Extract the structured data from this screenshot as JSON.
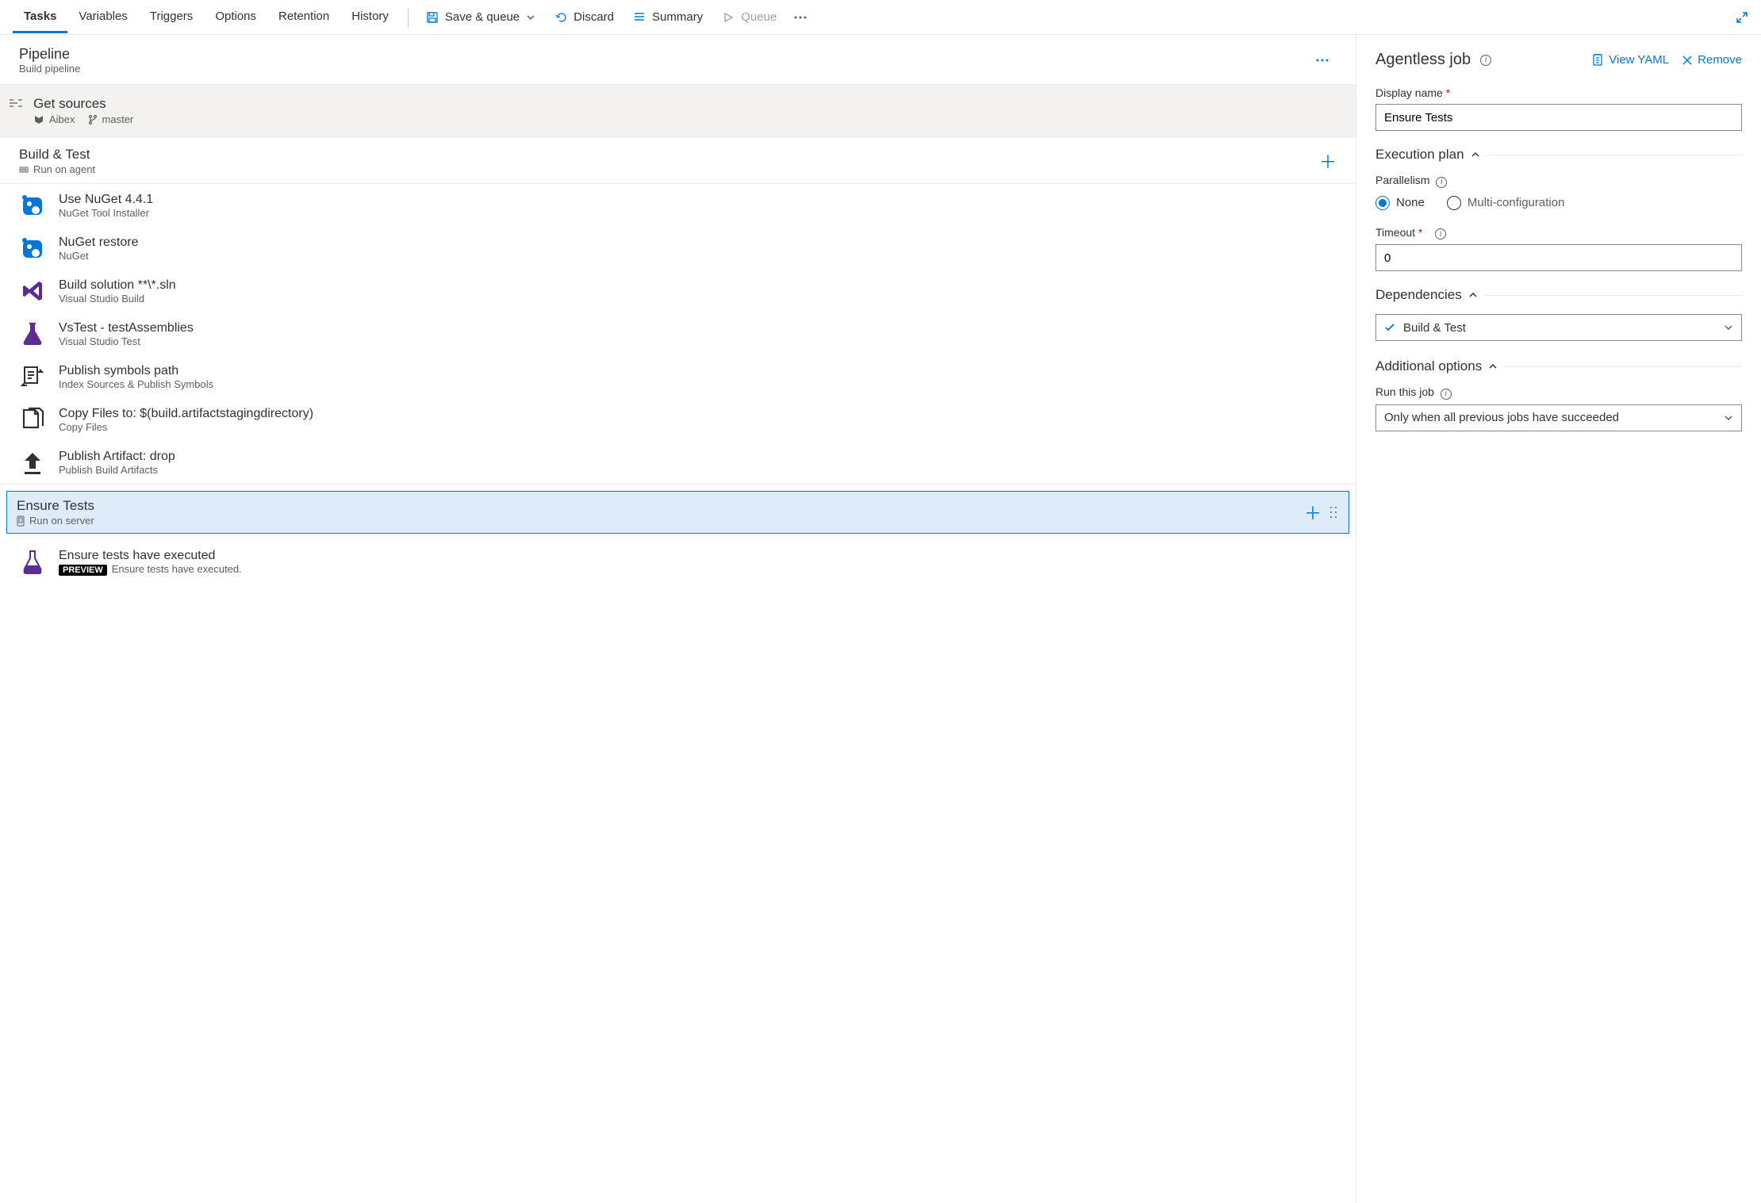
{
  "tabs": [
    "Tasks",
    "Variables",
    "Triggers",
    "Options",
    "Retention",
    "History"
  ],
  "tabs_active": 0,
  "toolbar": {
    "save_queue": "Save & queue",
    "discard": "Discard",
    "summary": "Summary",
    "queue": "Queue"
  },
  "pipeline": {
    "title": "Pipeline",
    "subtitle": "Build pipeline"
  },
  "get_sources": {
    "title": "Get sources",
    "repo": "Aibex",
    "branch": "master"
  },
  "job1": {
    "title": "Build & Test",
    "subtitle": "Run on agent",
    "tasks": [
      {
        "title": "Use NuGet 4.4.1",
        "sub": "NuGet Tool Installer",
        "icon": "nuget"
      },
      {
        "title": "NuGet restore",
        "sub": "NuGet",
        "icon": "nuget"
      },
      {
        "title": "Build solution **\\*.sln",
        "sub": "Visual Studio Build",
        "icon": "vs"
      },
      {
        "title": "VsTest - testAssemblies",
        "sub": "Visual Studio Test",
        "icon": "flask-purple"
      },
      {
        "title": "Publish symbols path",
        "sub": "Index Sources & Publish Symbols",
        "icon": "symbols"
      },
      {
        "title": "Copy Files to: $(build.artifactstagingdirectory)",
        "sub": "Copy Files",
        "icon": "copy"
      },
      {
        "title": "Publish Artifact: drop",
        "sub": "Publish Build Artifacts",
        "icon": "upload"
      }
    ]
  },
  "job2": {
    "title": "Ensure Tests",
    "subtitle": "Run on server",
    "tasks": [
      {
        "title": "Ensure tests have executed",
        "sub": "Ensure tests have executed.",
        "icon": "flask-outline",
        "preview": "PREVIEW"
      }
    ]
  },
  "right": {
    "heading": "Agentless job",
    "view_yaml": "View YAML",
    "remove": "Remove",
    "display_name_label": "Display name",
    "display_name_value": "Ensure Tests",
    "execution_plan": "Execution plan",
    "parallelism": "Parallelism",
    "parallel_none": "None",
    "parallel_multi": "Multi-configuration",
    "timeout_label": "Timeout",
    "timeout_value": "0",
    "dependencies": "Dependencies",
    "dep_value": "Build & Test",
    "additional": "Additional options",
    "run_label": "Run this job",
    "run_value": "Only when all previous jobs have succeeded"
  }
}
